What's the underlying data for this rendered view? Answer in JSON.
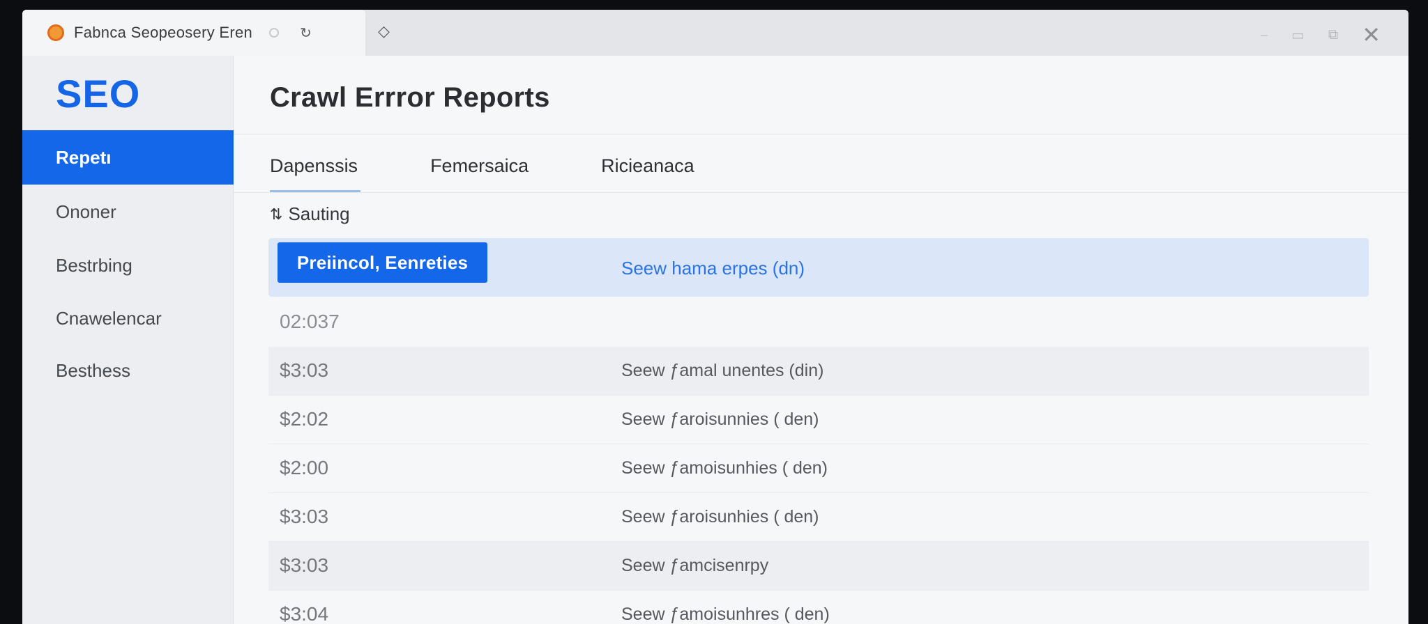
{
  "browser": {
    "tab_title": "Fabnca  Seopeosery Eren",
    "tab_close": "↻",
    "new_tab": "◇",
    "window_controls": [
      "⎯",
      "▭",
      "⧉"
    ],
    "close": "✕"
  },
  "sidebar": {
    "logo": "SEO",
    "items": [
      {
        "label": "Repetı"
      },
      {
        "label": "Ononer"
      },
      {
        "label": "Bestrbing"
      },
      {
        "label": "Cnawelencar"
      },
      {
        "label": "Besthess"
      }
    ]
  },
  "main": {
    "title": "Crawl Errror  Reports",
    "tabs": [
      {
        "label": "Dapenssis"
      },
      {
        "label": "Femersaica"
      },
      {
        "label": "Ricieanaca"
      }
    ],
    "filter_label": "Sauting",
    "highlight": {
      "button": "Preiincol, Eenreties",
      "link": "Seew hama erpes (dn)"
    },
    "first_time": "02:037",
    "rows": [
      {
        "time": "$3:03",
        "desc": "Seew ƒamal unentes (din)"
      },
      {
        "time": "$2:02",
        "desc": "Seew ƒaroisunnies ( den)"
      },
      {
        "time": "$2:00",
        "desc": "Seew ƒamoisunhies ( den)"
      },
      {
        "time": "$3:03",
        "desc": "Seew ƒaroisunhies ( den)"
      },
      {
        "time": "$3:03",
        "desc": "Seew ƒamcisenrpy"
      },
      {
        "time": "$3:04",
        "desc": "Seew ƒamoisunhres ( den)"
      }
    ]
  },
  "colors": {
    "accent": "#1467e8",
    "highlight_bg": "#dbe6f8",
    "link": "#2a74e0"
  }
}
